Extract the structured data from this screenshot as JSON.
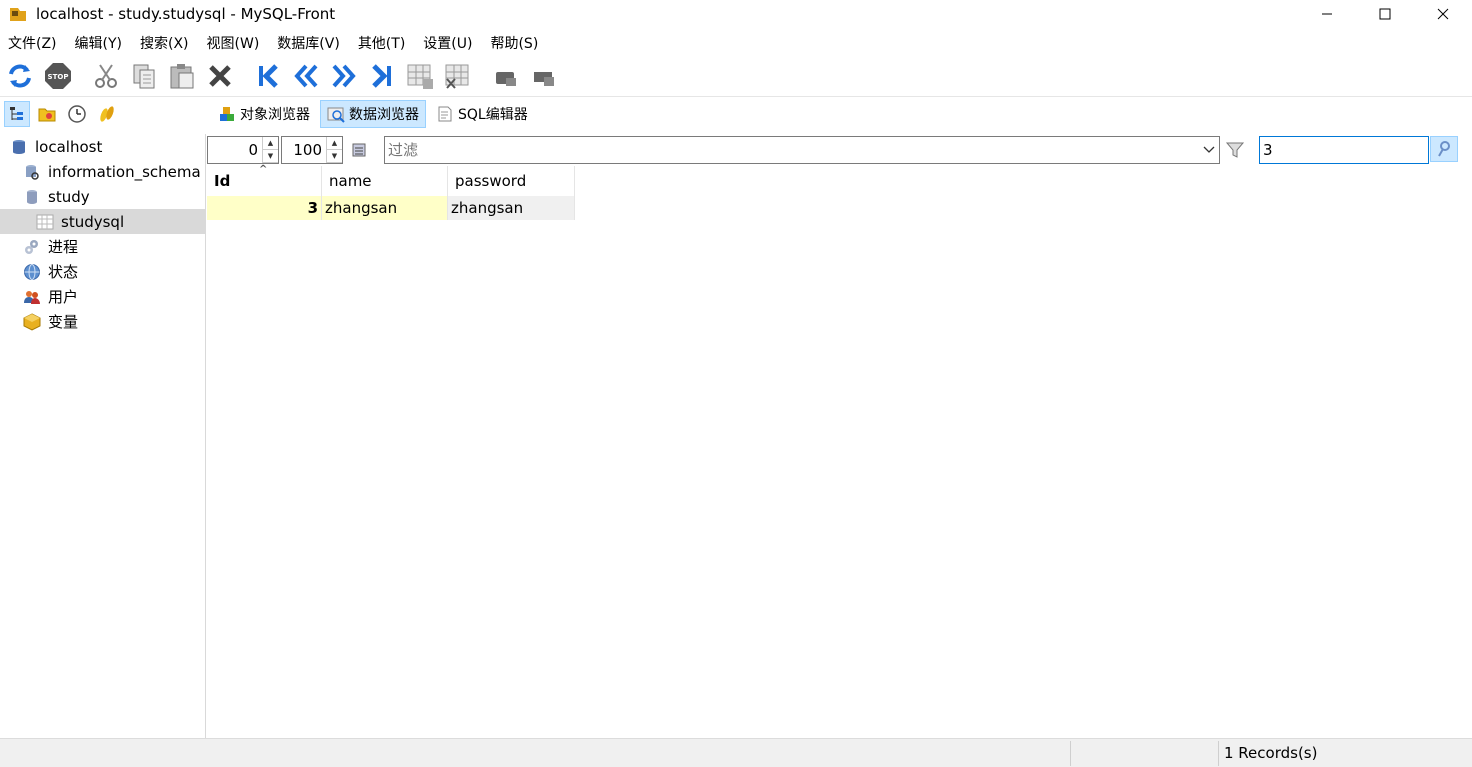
{
  "window": {
    "title": "localhost - study.studysql - MySQL-Front"
  },
  "menu": [
    "文件(Z)",
    "编辑(Y)",
    "搜索(X)",
    "视图(W)",
    "数据库(V)",
    "其他(T)",
    "设置(U)",
    "帮助(S)"
  ],
  "tabs": [
    {
      "label": "对象浏览器",
      "active": false
    },
    {
      "label": "数据浏览器",
      "active": true
    },
    {
      "label": "SQL编辑器",
      "active": false
    }
  ],
  "tree": [
    {
      "label": "localhost",
      "level": 0,
      "icon": "server-icon"
    },
    {
      "label": "information_schema",
      "level": 1,
      "icon": "system-database-icon"
    },
    {
      "label": "study",
      "level": 1,
      "icon": "database-icon"
    },
    {
      "label": "studysql",
      "level": 2,
      "icon": "table-icon",
      "selected": true
    },
    {
      "label": "进程",
      "level": 1,
      "icon": "processes-icon"
    },
    {
      "label": "状态",
      "level": 1,
      "icon": "status-globe-icon"
    },
    {
      "label": "用户",
      "level": 1,
      "icon": "users-icon"
    },
    {
      "label": "变量",
      "level": 1,
      "icon": "variables-icon"
    }
  ],
  "filterbar": {
    "offset": "0",
    "limit": "100",
    "filter_placeholder": "过滤",
    "search_value": "3"
  },
  "grid": {
    "columns": [
      "Id",
      "name",
      "password"
    ],
    "rows": [
      [
        "3",
        "zhangsan",
        "zhangsan"
      ]
    ]
  },
  "status": {
    "records": "1 Records(s)"
  },
  "colors": {
    "selection": "#cce8ff",
    "row_highlight": "#ffffc8",
    "accent_blue": "#1e6fd9"
  }
}
